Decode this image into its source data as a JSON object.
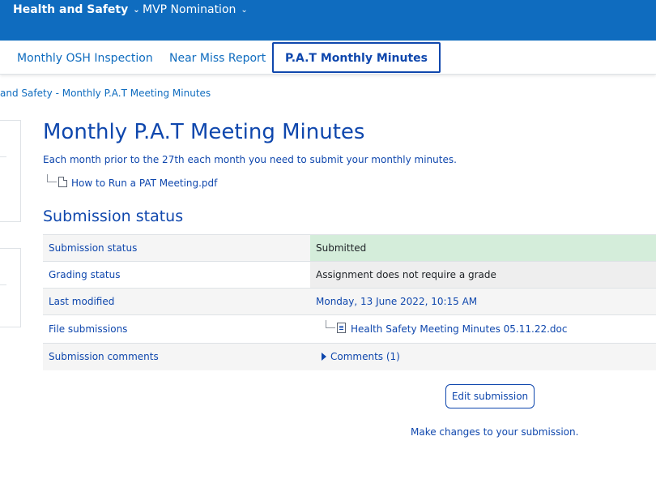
{
  "topbar": {
    "items": [
      {
        "label": "Health and Safety"
      },
      {
        "label": "MVP Nomination"
      }
    ]
  },
  "subnav": {
    "tabs": [
      {
        "label": "Monthly OSH Inspection"
      },
      {
        "label": "Near Miss Report"
      },
      {
        "label": "P.A.T Monthly Minutes",
        "active": true
      }
    ]
  },
  "breadcrumb": "and Safety - Monthly P.A.T Meeting Minutes",
  "assignment": {
    "title": "Monthly P.A.T Meeting Minutes",
    "description": "Each month prior to the 27th each month you need to submit your monthly minutes.",
    "attachment": "How to Run a PAT Meeting.pdf"
  },
  "submission": {
    "heading": "Submission status",
    "rows": {
      "status": {
        "label": "Submission status",
        "value": "Submitted"
      },
      "grading": {
        "label": "Grading status",
        "value": "Assignment does not require a grade"
      },
      "modified": {
        "label": "Last modified",
        "value": "Monday, 13 June 2022, 10:15 AM"
      },
      "files": {
        "label": "File submissions",
        "value": "Health Safety Meeting Minutes 05.11.22.doc"
      },
      "comments": {
        "label": "Submission comments",
        "value": "Comments (1)"
      }
    },
    "colors": {
      "submitted_bg": "#d4edda",
      "accent": "#0f47ad",
      "topbar": "#0f6cbf"
    }
  },
  "actions": {
    "edit_label": "Edit submission",
    "edit_help": "Make changes to your submission."
  }
}
